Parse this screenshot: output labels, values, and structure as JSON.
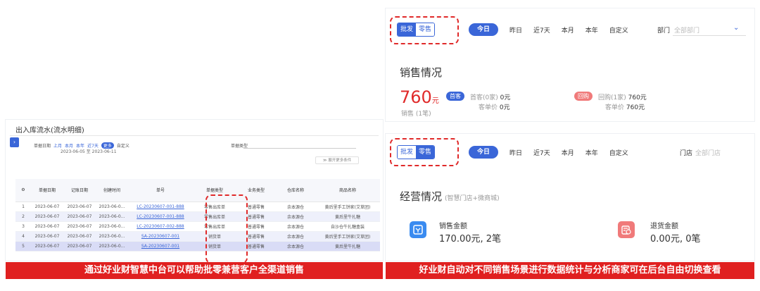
{
  "left": {
    "title": "出入库流水(流水明细)",
    "side_tab_icon": "chevron-right",
    "filter": {
      "label": "单据日期",
      "quick": [
        "上月",
        "本月",
        "本年",
        "近7天"
      ],
      "pill": "更多",
      "custom": "自定义",
      "range": "2023-06-05 至 2023-06-11"
    },
    "doc_type_label": "单据类型",
    "expand_label": "≫ 展开更多条件",
    "table": {
      "headers": [
        "⚙",
        "单据日期",
        "记账日期",
        "创建时间",
        "单号",
        "单据类型",
        "业务类型",
        "仓库名称",
        "商品名称"
      ],
      "rows": [
        [
          "1",
          "2023-06-07",
          "2023-06-07",
          "2023-06-0...",
          "LC-20230607-001-888",
          "零售出库单",
          "普通零售",
          "余本源仓",
          "黄后里手工饼家(艾草团)"
        ],
        [
          "2",
          "2023-06-07",
          "2023-06-07",
          "2023-06-0...",
          "LC-20230607-001-888",
          "零售出库单",
          "普通零售",
          "余本源仓",
          "黄后里牛扎糖"
        ],
        [
          "3",
          "2023-06-07",
          "2023-06-07",
          "2023-06-0...",
          "LC-20230607-002-888",
          "零售出库单",
          "普通零售",
          "余本源仓",
          "自沙仓牛扎糖盒装"
        ],
        [
          "4",
          "2023-06-07",
          "2023-06-07",
          "2023-06-0...",
          "SA-20230607-001",
          "销货单",
          "普通零售",
          "余本源仓",
          "黄后里手工饼家(艾草团)"
        ],
        [
          "5",
          "2023-06-07",
          "2023-06-07",
          "2023-06-0...",
          "SA-20230607-001",
          "销货单",
          "普通零售",
          "余本源仓",
          "黄后里牛扎糖"
        ]
      ]
    }
  },
  "right_top": {
    "toggle": [
      "批发",
      "零售"
    ],
    "time_options": [
      "今日",
      "昨日",
      "近7天",
      "本月",
      "本年",
      "自定义"
    ],
    "dept_label": "部门",
    "dept_placeholder": "全部部门",
    "title": "销售情况",
    "amount": "760",
    "amount_unit": "元",
    "sales_count": "销售 (1笔)",
    "first_tag": "首客",
    "first_line": "首客(0家)",
    "first_value": "0元",
    "first_unit_label": "客单价",
    "first_unit_value": "0元",
    "return_tag": "回购",
    "return_line": "回购(1家)",
    "return_value": "760元",
    "return_unit_label": "客单价",
    "return_unit_value": "760元"
  },
  "right_bottom": {
    "toggle": [
      "批发",
      "零售"
    ],
    "time_options": [
      "今日",
      "昨日",
      "近7天",
      "本月",
      "本年",
      "自定义"
    ],
    "store_label": "门店",
    "store_placeholder": "全部门店",
    "title": "经营情况",
    "subtitle": "(智慧门店+微商城)",
    "sales_label": "销售金额",
    "sales_value": "170.00元, 2笔",
    "refund_label": "退货金额",
    "refund_value": "0.00元, 0笔"
  },
  "captions": {
    "left": "通过好业财智慧中台可以帮助批零兼营客户全渠道销售",
    "right": "好业财自动对不同销售场景进行数据统计与分析商家可在后台自由切换查看"
  },
  "colors": {
    "accent": "#3a66d8",
    "highlight": "#e02020"
  }
}
